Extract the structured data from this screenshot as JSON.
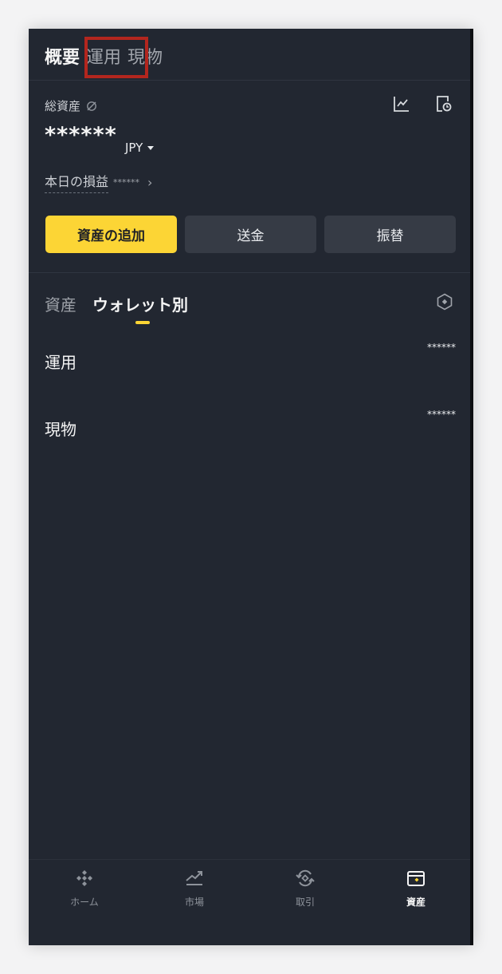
{
  "header": {
    "tabs": [
      {
        "label": "概要",
        "active": true
      },
      {
        "label": "運用",
        "active": false,
        "highlighted": true
      },
      {
        "label": "現物",
        "active": false
      }
    ]
  },
  "summary": {
    "total_label": "総資産",
    "balance": "******",
    "currency": "JPY",
    "pnl_label": "本日の損益",
    "pnl_value": "******",
    "icons": [
      "eye-off-icon",
      "chart-line-icon",
      "history-icon"
    ]
  },
  "actions": {
    "add_assets": "資産の追加",
    "send": "送金",
    "transfer": "振替"
  },
  "sub_tabs": {
    "assets": "資産",
    "by_wallet": "ウォレット別"
  },
  "wallets": [
    {
      "name": "運用",
      "value": "******"
    },
    {
      "name": "現物",
      "value": "******"
    }
  ],
  "nav": {
    "items": [
      {
        "label": "ホーム",
        "icon": "home-icon",
        "active": false
      },
      {
        "label": "市場",
        "icon": "market-icon",
        "active": false
      },
      {
        "label": "取引",
        "icon": "trade-icon",
        "active": false
      },
      {
        "label": "資産",
        "icon": "wallet-icon",
        "active": true
      }
    ]
  },
  "colors": {
    "background": "#222731",
    "accent": "#fcd535",
    "button_secondary": "#363b45",
    "highlight_box": "#b3261e"
  }
}
